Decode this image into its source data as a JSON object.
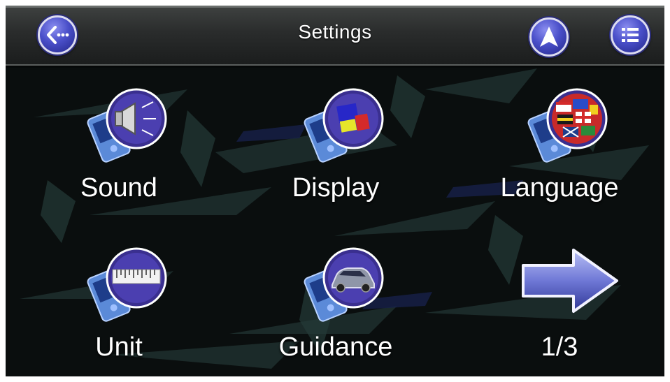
{
  "header": {
    "title": "Settings",
    "back_icon": "back-icon",
    "navigation_icon": "navigation-arrow-icon",
    "menu_icon": "list-menu-icon"
  },
  "menu": {
    "items": [
      {
        "label": "Sound",
        "icon": "speaker-icon"
      },
      {
        "label": "Display",
        "icon": "display-colors-icon"
      },
      {
        "label": "Language",
        "icon": "flags-icon"
      },
      {
        "label": "Unit",
        "icon": "ruler-icon"
      },
      {
        "label": "Guidance",
        "icon": "car-icon"
      }
    ],
    "next_page_icon": "next-arrow-icon",
    "page_indicator": "1/3"
  },
  "colors": {
    "button_accent": "#4a4fc9",
    "background": "#0b0f0f",
    "text": "#ffffff"
  }
}
